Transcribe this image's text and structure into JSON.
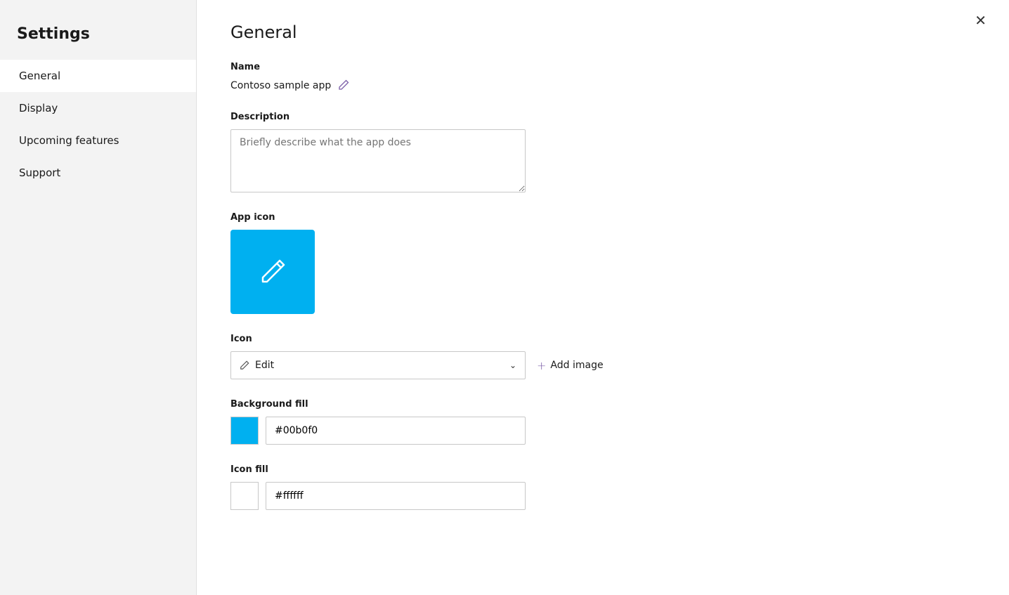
{
  "sidebar": {
    "title": "Settings",
    "items": [
      {
        "id": "general",
        "label": "General",
        "active": true
      },
      {
        "id": "display",
        "label": "Display",
        "active": false
      },
      {
        "id": "upcoming-features",
        "label": "Upcoming features",
        "active": false
      },
      {
        "id": "support",
        "label": "Support",
        "active": false
      }
    ]
  },
  "main": {
    "page_title": "General",
    "close_button_label": "✕",
    "name_section": {
      "label": "Name",
      "value": "Contoso sample app",
      "edit_icon_title": "Edit name"
    },
    "description_section": {
      "label": "Description",
      "placeholder": "Briefly describe what the app does"
    },
    "app_icon_section": {
      "label": "App icon",
      "background_color": "#00b0f0"
    },
    "icon_section": {
      "label": "Icon",
      "select_value": "Edit",
      "add_image_label": "Add image"
    },
    "background_fill_section": {
      "label": "Background fill",
      "color": "#00b0f0",
      "value": "#00b0f0"
    },
    "icon_fill_section": {
      "label": "Icon fill",
      "color": "#ffffff",
      "value": "#ffffff"
    }
  }
}
